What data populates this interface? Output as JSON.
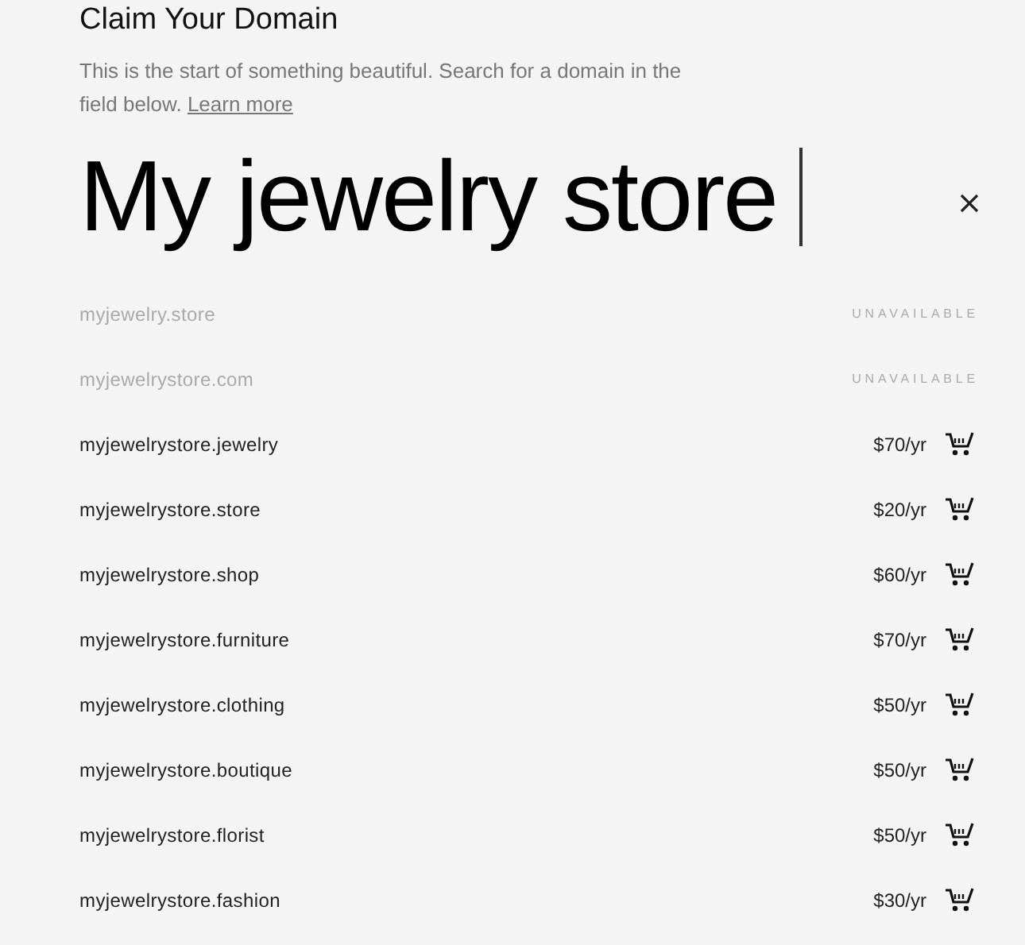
{
  "title": "Claim Your Domain",
  "description": {
    "text": "This is the start of something beautiful. Search for a domain in the field below.",
    "link": "Learn more"
  },
  "search": {
    "value": "My jewelry store"
  },
  "domains": [
    {
      "name": "myjewelry.store",
      "available": false,
      "status": "UNAVAILABLE"
    },
    {
      "name": "myjewelrystore.com",
      "available": false,
      "status": "UNAVAILABLE"
    },
    {
      "name": "myjewelrystore.jewelry",
      "available": true,
      "price": "$70/yr"
    },
    {
      "name": "myjewelrystore.store",
      "available": true,
      "price": "$20/yr"
    },
    {
      "name": "myjewelrystore.shop",
      "available": true,
      "price": "$60/yr"
    },
    {
      "name": "myjewelrystore.furniture",
      "available": true,
      "price": "$70/yr"
    },
    {
      "name": "myjewelrystore.clothing",
      "available": true,
      "price": "$50/yr"
    },
    {
      "name": "myjewelrystore.boutique",
      "available": true,
      "price": "$50/yr"
    },
    {
      "name": "myjewelrystore.florist",
      "available": true,
      "price": "$50/yr"
    },
    {
      "name": "myjewelrystore.fashion",
      "available": true,
      "price": "$30/yr"
    }
  ]
}
